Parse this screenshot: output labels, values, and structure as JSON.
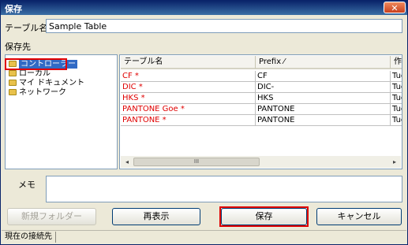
{
  "window": {
    "title": "保存",
    "close_glyph": "✕"
  },
  "form": {
    "table_name_label": "テーブル名",
    "table_name_value": "Sample Table",
    "save_dest_label": "保存先",
    "memo_label": "メモ",
    "memo_value": ""
  },
  "tree": {
    "items": [
      {
        "label": "コントローラー",
        "selected": true
      },
      {
        "label": "ローカル",
        "selected": false
      },
      {
        "label": "マイ ドキュメント",
        "selected": false
      },
      {
        "label": "ネットワーク",
        "selected": false
      }
    ]
  },
  "list": {
    "columns": [
      {
        "label": "テーブル名"
      },
      {
        "label": "Prefix ⁄"
      },
      {
        "label": "作"
      }
    ],
    "rows": [
      {
        "name": "CF  *",
        "prefix": "CF",
        "date": "Tue"
      },
      {
        "name": "DIC  *",
        "prefix": "DIC-",
        "date": "Tue"
      },
      {
        "name": "HKS  *",
        "prefix": "HKS",
        "date": "Tue"
      },
      {
        "name": "PANTONE Goe  *",
        "prefix": "PANTONE",
        "date": "Tue"
      },
      {
        "name": "PANTONE  *",
        "prefix": "PANTONE",
        "date": "Tue"
      }
    ],
    "scroll_left": "◂",
    "scroll_right": "▸",
    "thumb_grip": "III"
  },
  "buttons": {
    "new_folder": "新規フォルダー",
    "refresh": "再表示",
    "save": "保存",
    "cancel": "キャンセル"
  },
  "status": {
    "connection": "現在の接続先"
  },
  "colors": {
    "accent_highlight": "#e00000",
    "asterisk_text": "#e00000",
    "selection": "#316ac5"
  }
}
